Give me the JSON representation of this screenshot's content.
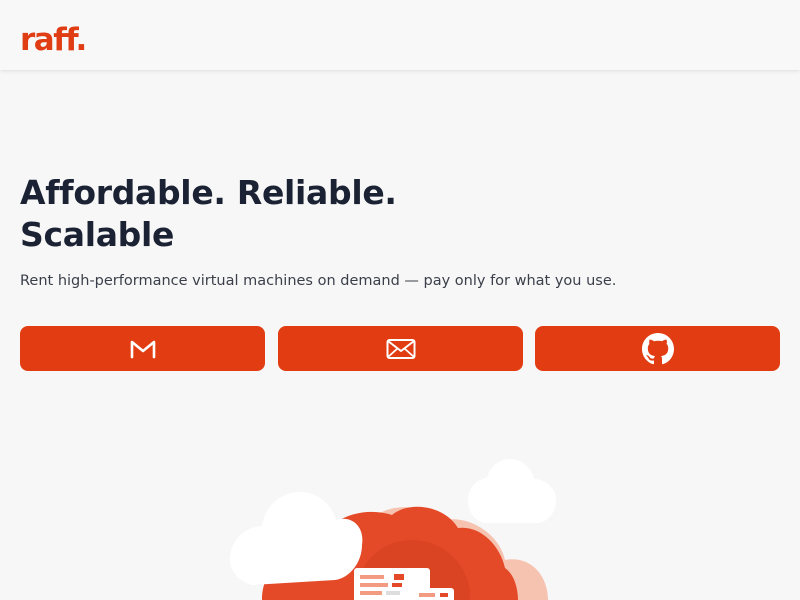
{
  "header": {
    "logo_text": "raff."
  },
  "hero": {
    "title_line1": "Affordable. Reliable.",
    "title_line2": "Scalable",
    "subtitle": "Rent high-performance virtual machines on demand — pay only for what you use."
  },
  "auth_buttons": [
    {
      "icon": "gmail-icon"
    },
    {
      "icon": "mail-icon"
    },
    {
      "icon": "github-icon"
    }
  ],
  "colors": {
    "brand": "#e23d12",
    "title_text": "#1b2233",
    "background": "#f7f7f7"
  }
}
